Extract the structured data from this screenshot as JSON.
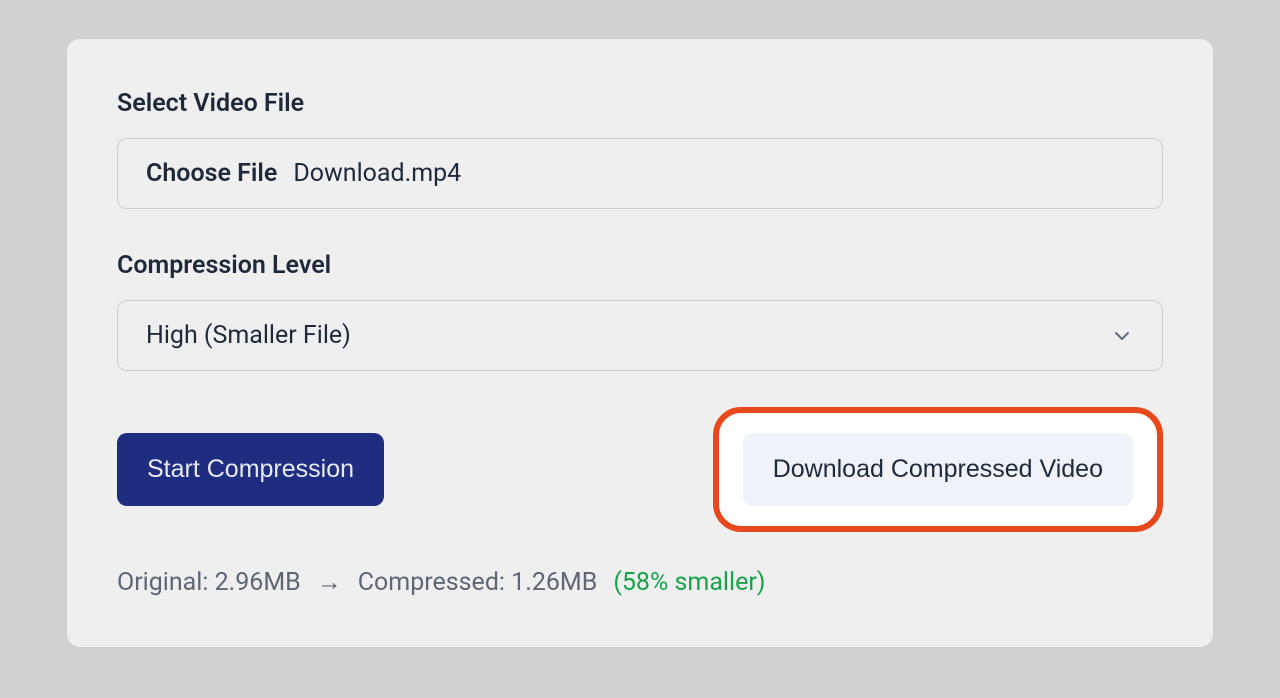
{
  "file_section": {
    "label": "Select Video File",
    "choose_label": "Choose File",
    "file_name": "Download.mp4"
  },
  "compression_section": {
    "label": "Compression Level",
    "selected_value": "High (Smaller File)"
  },
  "buttons": {
    "start_label": "Start Compression",
    "download_label": "Download Compressed Video"
  },
  "stats": {
    "original": "Original: 2.96MB",
    "arrow": "→",
    "compressed": "Compressed: 1.26MB",
    "reduction": "(58% smaller)"
  }
}
